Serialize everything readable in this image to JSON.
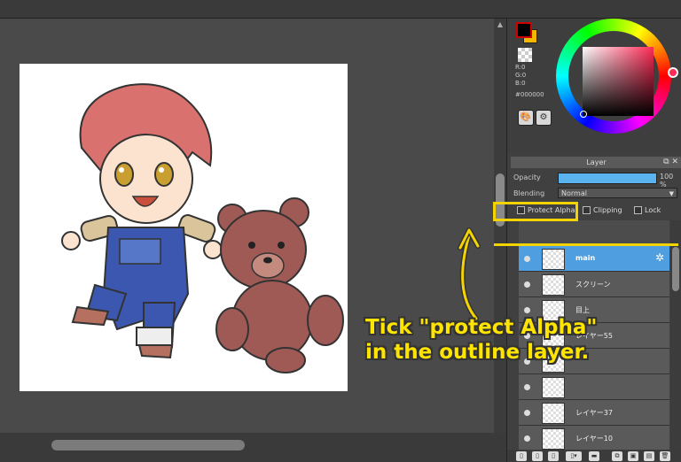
{
  "color_panel": {
    "rgb_r": "R:0",
    "rgb_g": "G:0",
    "rgb_b": "B:0",
    "hex": "#000000",
    "foreground_color": "#000000",
    "background_color": "#f5b800",
    "selected_hue_color": "#ff2a55"
  },
  "layer_panel": {
    "title": "Layer",
    "opacity_label": "Opacity",
    "opacity_value": "100 %",
    "opacity_fraction": 1.0,
    "blending_label": "Blending",
    "blending_value": "Normal",
    "protect_alpha_label": "Protect Alpha",
    "clipping_label": "Clipping",
    "lock_label": "Lock",
    "layers": [
      {
        "name": "main",
        "selected": true
      },
      {
        "name": "スクリーン",
        "selected": false
      },
      {
        "name": "目上",
        "selected": false
      },
      {
        "name": "レイヤー55",
        "selected": false
      },
      {
        "name": "",
        "selected": false
      },
      {
        "name": "",
        "selected": false
      },
      {
        "name": "レイヤー37",
        "selected": false
      },
      {
        "name": "レイヤー10",
        "selected": false
      }
    ]
  },
  "annotation": {
    "line1": "Tick \"protect Alpha\"",
    "line2": "in the outline layer.",
    "highlight_color": "#f4d400"
  }
}
